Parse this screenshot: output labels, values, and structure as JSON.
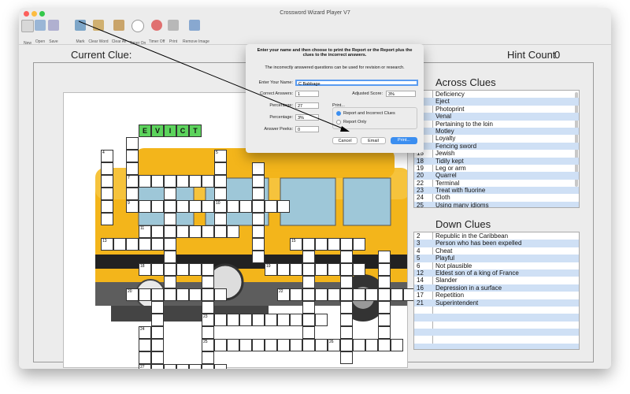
{
  "window": {
    "title": "Crossword Wizard Player V7"
  },
  "toolbar": {
    "items": [
      {
        "label": "New",
        "icon": "new-document-icon",
        "color": "#c9c9c9"
      },
      {
        "label": "Open",
        "icon": "folder-icon",
        "color": "#9ab6d6"
      },
      {
        "label": "Save",
        "icon": "save-icon",
        "color": "#b0b0d0"
      },
      {
        "label": "Mark",
        "icon": "mark-icon",
        "color": "#7ea6c8"
      },
      {
        "label": "Clear Word",
        "icon": "eraser-icon",
        "color": "#d0b070"
      },
      {
        "label": "Clear All",
        "icon": "broom-icon",
        "color": "#c9a46a"
      },
      {
        "label": "Timer On",
        "icon": "clock-icon",
        "color": "#b8b8b8"
      },
      {
        "label": "Timer Off",
        "icon": "stop-timer-icon",
        "color": "#e07070"
      },
      {
        "label": "Print",
        "icon": "printer-icon",
        "color": "#a8a8a8"
      },
      {
        "label": "Remove Image",
        "icon": "image-icon",
        "color": "#88a8d0"
      }
    ]
  },
  "main": {
    "current_clue_label": "Current Clue:",
    "hint_count_label": "Hint Count",
    "hint_count": "0"
  },
  "grid": {
    "guess_letters": [
      "E",
      "V",
      "I",
      "C",
      "T"
    ],
    "accent": "#5cd35c"
  },
  "across": {
    "title": "Across Clues",
    "clues": [
      {
        "num": "1",
        "text": "Deficiency"
      },
      {
        "num": "3",
        "text": "Eject"
      },
      {
        "num": "7",
        "text": "Photoprint"
      },
      {
        "num": "8",
        "text": "Venal"
      },
      {
        "num": "9",
        "text": "Pertaining to the loin"
      },
      {
        "num": "10",
        "text": "Motley"
      },
      {
        "num": "11",
        "text": "Loyalty"
      },
      {
        "num": "13",
        "text": "Fencing sword"
      },
      {
        "num": "15",
        "text": "Jewish"
      },
      {
        "num": "18",
        "text": "Tidily kept"
      },
      {
        "num": "19",
        "text": "Leg or arm"
      },
      {
        "num": "20",
        "text": "Quarrel"
      },
      {
        "num": "22",
        "text": "Terminal"
      },
      {
        "num": "23",
        "text": "Treat with fluorine"
      },
      {
        "num": "24",
        "text": "Cloth"
      },
      {
        "num": "25",
        "text": "Using many idioms"
      }
    ]
  },
  "down": {
    "title": "Down Clues",
    "clues": [
      {
        "num": "2",
        "text": "Republic in the Caribbean"
      },
      {
        "num": "3",
        "text": "Person who has been expelled"
      },
      {
        "num": "4",
        "text": "Cheat"
      },
      {
        "num": "5",
        "text": "Playful"
      },
      {
        "num": "6",
        "text": "Not plausible"
      },
      {
        "num": "12",
        "text": "Eldest son of a king of France"
      },
      {
        "num": "14",
        "text": "Slander"
      },
      {
        "num": "16",
        "text": "Depression in a surface"
      },
      {
        "num": "17",
        "text": "Repetition"
      },
      {
        "num": "21",
        "text": "Superintendent"
      }
    ]
  },
  "dialog": {
    "instruction": "Enter your name and then choose to print the Report or the Report plus the clues to the incorrect answers.",
    "note": "The incorrectly answered questions can be used for revision or research.",
    "name_label": "Enter Your Name:",
    "name_value": "C Babbage",
    "correct_label": "Correct Answers:",
    "correct_value": "1",
    "adjusted_label": "Adjusted Score:",
    "adjusted_value": "3%",
    "percentage_label": "Percentage:",
    "percentage_value": "27",
    "print_label": "Print...",
    "percentage2_label": "Percentage:",
    "percentage2_value": "3%",
    "radio_report_incorrect": "Report and Incorrect Clues",
    "radio_report_only": "Report Only",
    "peeks_label": "Answer Peeks:",
    "peeks_value": "0",
    "cancel_button": "Cancel",
    "email_button": "Email",
    "print_button": "Print...",
    "accent": "#3b8ef0"
  }
}
